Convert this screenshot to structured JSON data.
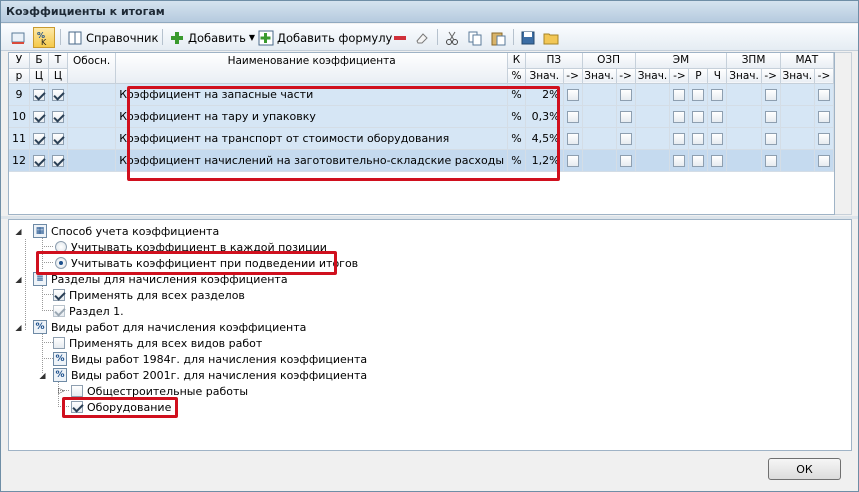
{
  "window": {
    "title": "Коэффициенты к итогам"
  },
  "toolbar": {
    "reference_label": "Справочник",
    "add_label": "Добавить",
    "add_formula_label": "Добавить формулу"
  },
  "grid": {
    "headers": {
      "u": "У",
      "b": "Б",
      "t": "Т",
      "r": "р",
      "ts1": "Ц",
      "ts2": "Ц",
      "basis": "Обосн.",
      "name": "Наименование коэффициента",
      "k": "К",
      "pct": "%",
      "pz": "ПЗ",
      "ozp": "ОЗП",
      "em": "ЭМ",
      "zpm": "ЗПМ",
      "mat": "МАТ",
      "val": "Знач.",
      "arrow": "->",
      "p": "Р",
      "ch": "Ч"
    },
    "rows": [
      {
        "num": "9",
        "b": true,
        "t": true,
        "basis": "",
        "name": "Коэффициент на запасные части",
        "k": "%",
        "value": "2%"
      },
      {
        "num": "10",
        "b": true,
        "t": true,
        "basis": "",
        "name": "Коэффициент на тару и упаковку",
        "k": "%",
        "value": "0,3%"
      },
      {
        "num": "11",
        "b": true,
        "t": true,
        "basis": "",
        "name": "Коэффициент на транспорт от стоимости оборудования",
        "k": "%",
        "value": "4,5%"
      },
      {
        "num": "12",
        "b": true,
        "t": true,
        "basis": "",
        "name": "Коэффициент начислений на заготовительно-складские расходы",
        "k": "%",
        "value": "1,2%"
      }
    ]
  },
  "tree": {
    "method": {
      "label": "Способ учета коэффициента",
      "icon": "grid-icon"
    },
    "method_each": {
      "label": "Учитывать коэффициент в каждой позиции",
      "selected": false
    },
    "method_totals": {
      "label": "Учитывать коэффициент при подведении итогов",
      "selected": true
    },
    "sections": {
      "label": "Разделы для начисления коэффициента"
    },
    "sections_all": {
      "label": "Применять для всех разделов",
      "checked": true
    },
    "section1": {
      "label": "Раздел 1.",
      "checked": true
    },
    "worktypes": {
      "label": "Виды работ для начисления коэффициента",
      "icon_text": "%"
    },
    "worktypes_all": {
      "label": "Применять для всех видов работ",
      "checked": false
    },
    "wt1984": {
      "label": "Виды работ 1984г. для начисления коэффициента",
      "icon_text": "%"
    },
    "wt2001": {
      "label": "Виды работ 2001г. для начисления коэффициента",
      "icon_text": "%"
    },
    "general": {
      "label": "Общестроительные работы",
      "checked": false
    },
    "equipment": {
      "label": "Оборудование",
      "checked": true
    }
  },
  "footer": {
    "ok_label": "ОК"
  },
  "colors": {
    "highlight": "#d0101e",
    "row_bg": "#d6e6f5"
  }
}
